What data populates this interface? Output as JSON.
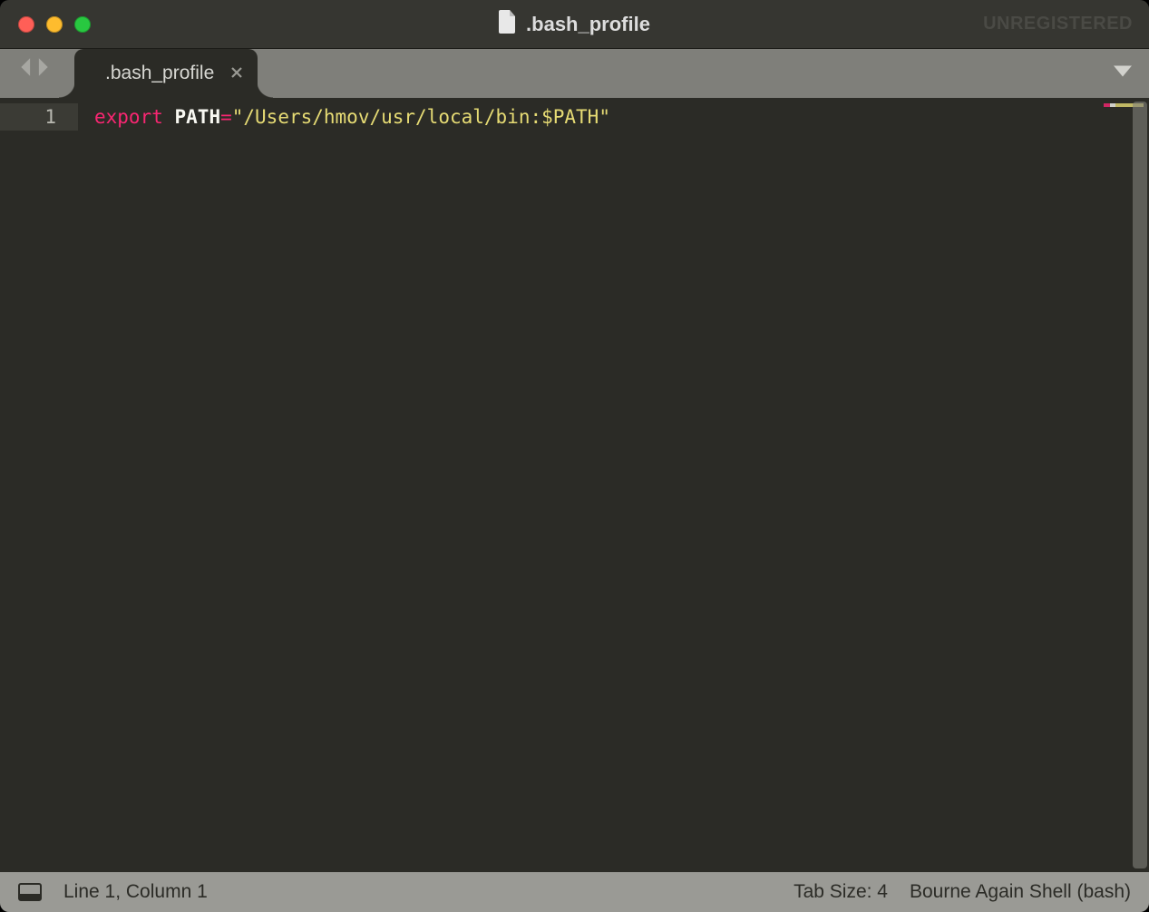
{
  "titlebar": {
    "filename": ".bash_profile",
    "registration": "UNREGISTERED"
  },
  "tabs": [
    {
      "label": ".bash_profile",
      "active": true
    }
  ],
  "editor": {
    "lines": [
      {
        "number": "1",
        "tokens": {
          "keyword": "export",
          "sep_after_keyword": " ",
          "variable": "PATH",
          "operator": "=",
          "string": "\"/Users/hmov/usr/local/bin:$PATH\""
        }
      }
    ]
  },
  "statusbar": {
    "cursor": "Line 1, Column 1",
    "tabsize": "Tab Size: 4",
    "syntax": "Bourne Again Shell (bash)"
  },
  "icons": {
    "file": "file-icon",
    "close": "close-icon",
    "nav_back": "chevron-left-icon",
    "nav_forward": "chevron-right-icon",
    "tab_menu": "chevron-down-icon",
    "panel": "panel-icon"
  }
}
